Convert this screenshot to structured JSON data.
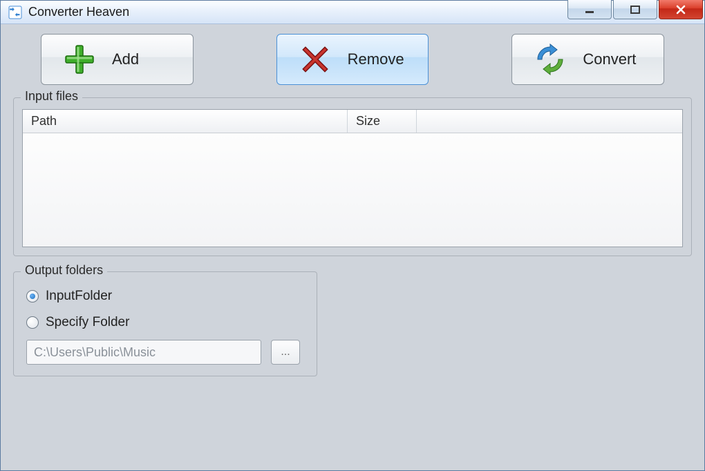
{
  "window": {
    "title": "Converter Heaven"
  },
  "toolbar": {
    "add_label": "Add",
    "remove_label": "Remove",
    "convert_label": "Convert"
  },
  "input_files": {
    "legend": "Input files",
    "columns": {
      "path": "Path",
      "size": "Size"
    },
    "rows": []
  },
  "output": {
    "legend": "Output folders",
    "radio_input_folder": "InputFolder",
    "radio_specify_folder": "Specify Folder",
    "selected": "input_folder",
    "path_value": "C:\\Users\\Public\\Music",
    "browse_label": "..."
  }
}
